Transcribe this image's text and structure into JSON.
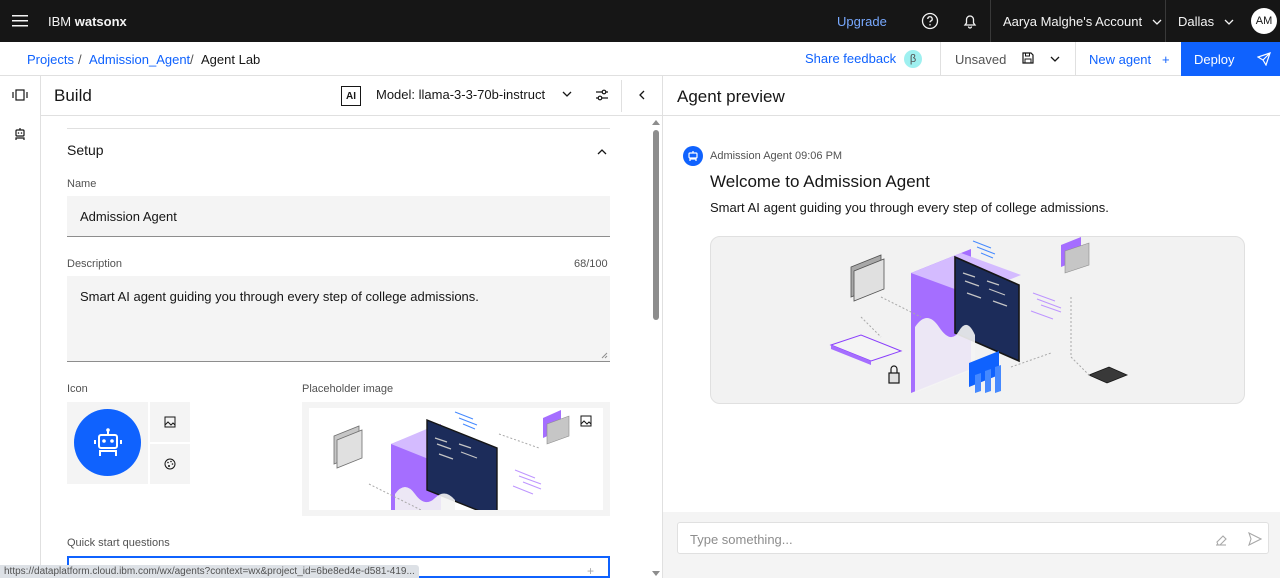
{
  "topbar": {
    "brand_prefix": "IBM",
    "brand_name": "watsonx",
    "upgrade": "Upgrade",
    "account": "Aarya Malghe's Account",
    "region": "Dallas",
    "avatar_initials": "AM"
  },
  "breadcrumb": {
    "items": [
      "Projects",
      "Admission_Agent",
      "Agent Lab"
    ],
    "separator": "/"
  },
  "subbar": {
    "share_feedback": "Share feedback",
    "beta": "β",
    "status": "Unsaved",
    "new_agent": "New agent",
    "new_agent_icon": "+",
    "deploy": "Deploy"
  },
  "build": {
    "title": "Build",
    "ai_badge": "AI",
    "model": "Model: llama-3-3-70b-instruct",
    "setup_title": "Setup",
    "name_label": "Name",
    "name_value": "Admission Agent",
    "description_label": "Description",
    "description_count": "68/100",
    "description_value": "Smart AI agent guiding you through every step of college admissions.",
    "icon_label": "Icon",
    "placeholder_label": "Placeholder image",
    "quick_start_label": "Quick start questions",
    "quick_start_add": "+"
  },
  "status_url": "https://dataplatform.cloud.ibm.com/wx/agents?context=wx&project_id=6be8ed4e-d581-419...",
  "preview": {
    "title": "Agent preview",
    "message_meta": "Admission Agent 09:06 PM",
    "message_title": "Welcome to Admission Agent",
    "message_desc": "Smart AI agent guiding you through every step of college admissions.",
    "input_placeholder": "Type something..."
  },
  "colors": {
    "brand_blue": "#0f62fe",
    "topbar_bg": "#161616",
    "link_blue": "#0f62fe",
    "upgrade_blue": "#78a9ff",
    "beta_bg": "#9ef0f0",
    "illustration_purple": "#8a3ffc"
  },
  "icons": [
    "menu-icon",
    "help-icon",
    "notification-icon",
    "chevron-down-icon",
    "save-icon",
    "send-icon",
    "robot-icon",
    "image-icon",
    "palette-icon",
    "settings-sliders-icon",
    "collapse-icon",
    "eraser-icon",
    "chevron-up-icon"
  ]
}
